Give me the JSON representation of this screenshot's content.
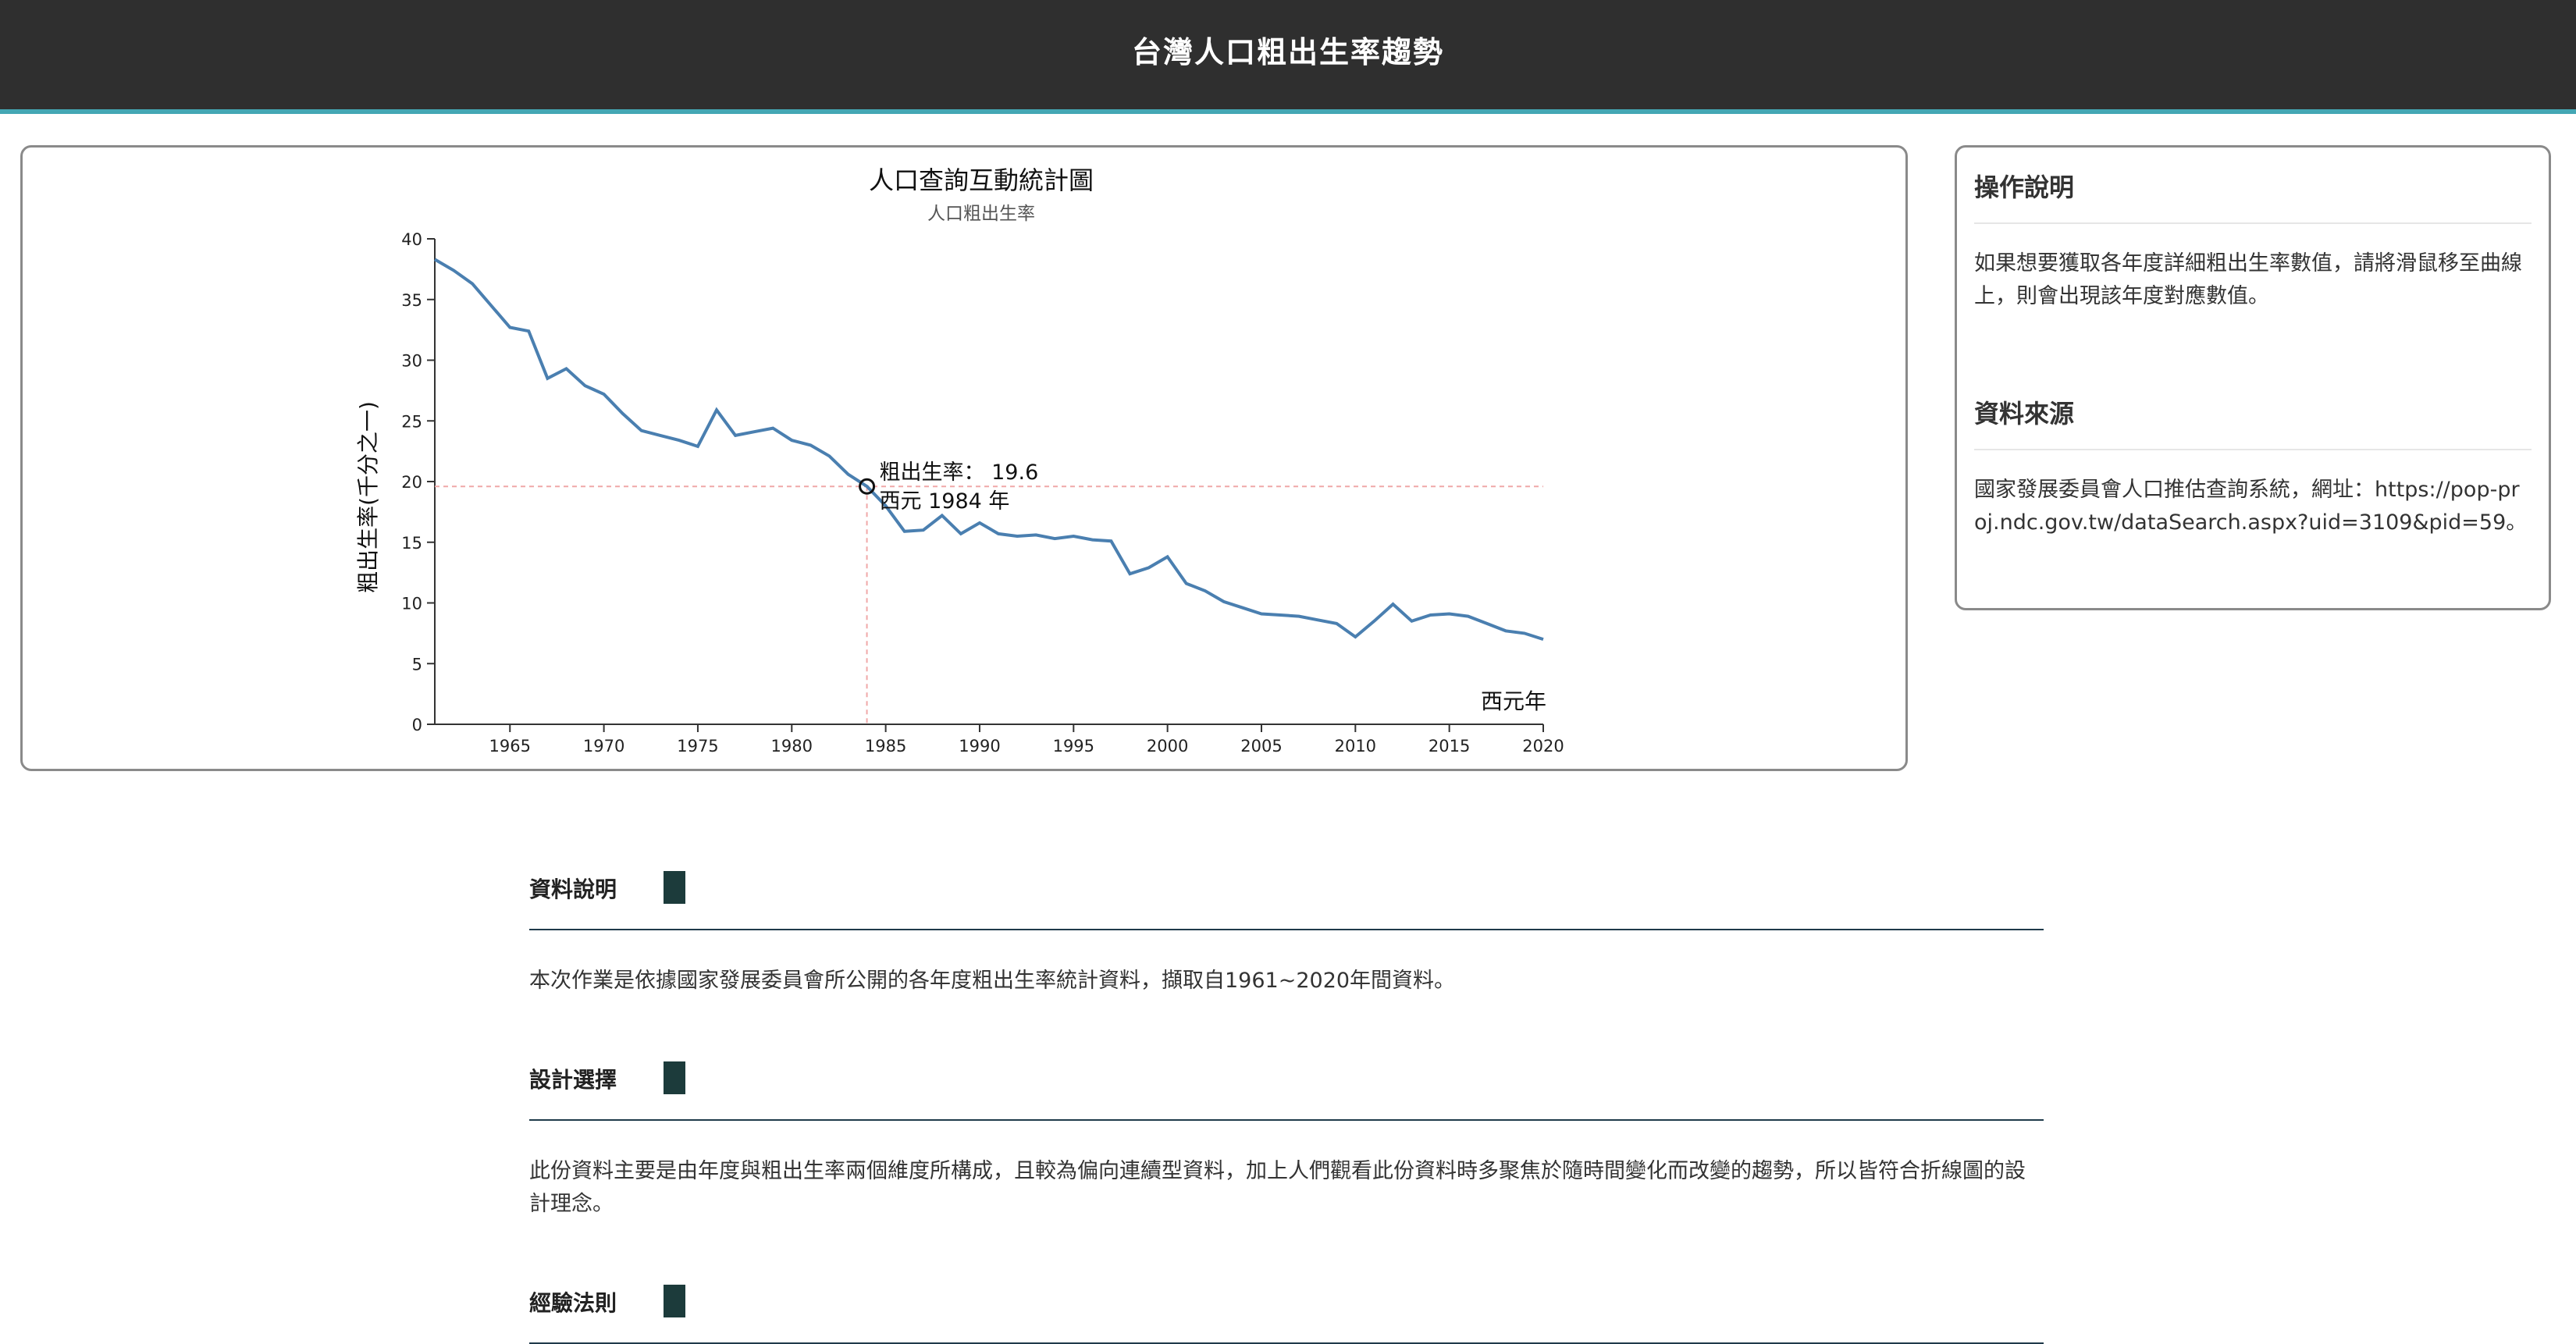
{
  "header": {
    "title": "台灣人口粗出生率趨勢"
  },
  "chart_data": {
    "type": "line",
    "title": "人口查詢互動統計圖",
    "subtitle": "人口粗出生率",
    "xlabel": "西元年",
    "ylabel": "粗出生率(千分之一)",
    "xlim": [
      1961,
      2020
    ],
    "ylim": [
      0,
      40
    ],
    "x_ticks": [
      1965,
      1970,
      1975,
      1980,
      1985,
      1990,
      1995,
      2000,
      2005,
      2010,
      2015,
      2020
    ],
    "y_ticks": [
      0,
      5,
      10,
      15,
      20,
      25,
      30,
      35,
      40
    ],
    "grid": false,
    "line_color": "#4a7fb0",
    "x": [
      1961,
      1962,
      1963,
      1964,
      1965,
      1966,
      1967,
      1968,
      1969,
      1970,
      1971,
      1972,
      1973,
      1974,
      1975,
      1976,
      1977,
      1978,
      1979,
      1980,
      1981,
      1982,
      1983,
      1984,
      1985,
      1986,
      1987,
      1988,
      1989,
      1990,
      1991,
      1992,
      1993,
      1994,
      1995,
      1996,
      1997,
      1998,
      1999,
      2000,
      2001,
      2002,
      2003,
      2004,
      2005,
      2006,
      2007,
      2008,
      2009,
      2010,
      2011,
      2012,
      2013,
      2014,
      2015,
      2016,
      2017,
      2018,
      2019,
      2020
    ],
    "values": [
      38.3,
      37.4,
      36.3,
      34.5,
      32.7,
      32.4,
      28.5,
      29.3,
      27.9,
      27.2,
      25.6,
      24.2,
      23.8,
      23.4,
      22.9,
      25.9,
      23.8,
      24.1,
      24.4,
      23.4,
      23.0,
      22.1,
      20.6,
      19.6,
      18.0,
      15.9,
      16.0,
      17.2,
      15.7,
      16.6,
      15.7,
      15.5,
      15.6,
      15.3,
      15.5,
      15.2,
      15.1,
      12.4,
      12.9,
      13.8,
      11.6,
      11.0,
      10.1,
      9.6,
      9.1,
      9.0,
      8.9,
      8.6,
      8.3,
      7.2,
      8.5,
      9.9,
      8.5,
      9.0,
      9.1,
      8.9,
      8.3,
      7.7,
      7.5,
      7.0
    ],
    "tooltip": {
      "year": 1984,
      "value": 19.6,
      "rate_text": "粗出生率： 19.6",
      "year_text": "西元 1984 年",
      "crosshair_color": "#f0a8a8"
    }
  },
  "instructions": {
    "heading": "操作說明",
    "text": "如果想要獲取各年度詳細粗出生率數值，請將滑鼠移至曲線上，則會出現該年度對應數值。"
  },
  "source": {
    "heading": "資料來源",
    "text": "國家發展委員會人口推估查詢系統，網址：https://pop-proj.ndc.gov.tw/dataSearch.aspx?uid=3109&pid=59。"
  },
  "sections": [
    {
      "title": "資料說明",
      "text": "本次作業是依據國家發展委員會所公開的各年度粗出生率統計資料，擷取自1961~2020年間資料。"
    },
    {
      "title": "設計選擇",
      "text": "此份資料主要是由年度與粗出生率兩個維度所構成，且較為偏向連續型資料，加上人們觀看此份資料時多聚焦於隨時間變化而改變的趨勢，所以皆符合折線圖的設計理念。"
    },
    {
      "title": "經驗法則",
      "text": ""
    }
  ],
  "colors": {
    "header_bg": "#2f2f2f",
    "header_accent": "#44a7b4",
    "section_block": "#1c3b3b",
    "section_rule": "#1f3a4a"
  }
}
